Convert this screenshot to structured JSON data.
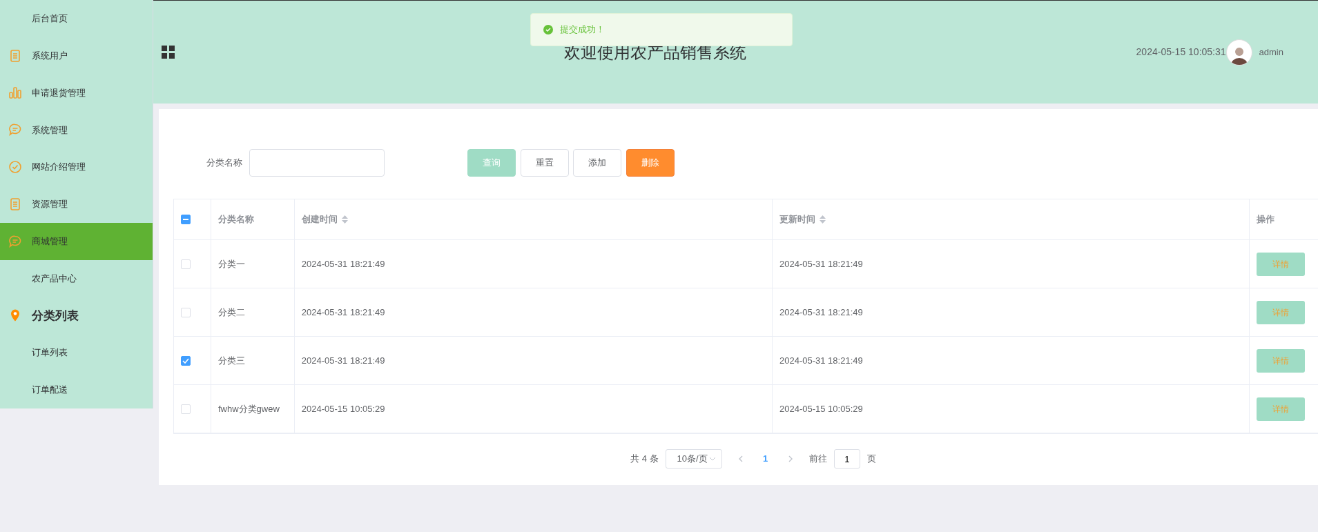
{
  "sidebar": {
    "items": [
      {
        "label": "后台首页",
        "kind": "plain",
        "selected": false,
        "emphasized": false
      },
      {
        "label": "系统用户",
        "kind": "document",
        "selected": false,
        "emphasized": false
      },
      {
        "label": "申请退货管理",
        "kind": "chart",
        "selected": false,
        "emphasized": false
      },
      {
        "label": "系统管理",
        "kind": "chat",
        "selected": false,
        "emphasized": false
      },
      {
        "label": "网站介绍管理",
        "kind": "check",
        "selected": false,
        "emphasized": false
      },
      {
        "label": "资源管理",
        "kind": "document",
        "selected": false,
        "emphasized": false
      },
      {
        "label": "商城管理",
        "kind": "chat",
        "selected": true,
        "emphasized": false
      },
      {
        "label": "农产品中心",
        "kind": "plain",
        "selected": false,
        "emphasized": false
      },
      {
        "label": "分类列表",
        "kind": "pin",
        "selected": false,
        "emphasized": true
      },
      {
        "label": "订单列表",
        "kind": "plain",
        "selected": false,
        "emphasized": false
      },
      {
        "label": "订单配送",
        "kind": "plain",
        "selected": false,
        "emphasized": false
      }
    ]
  },
  "header": {
    "title": "欢迎使用农产品销售系统",
    "datetime": "2024-05-15 10:05:31",
    "username": "admin"
  },
  "toast": {
    "message": "提交成功！"
  },
  "search": {
    "label": "分类名称"
  },
  "buttons": [
    {
      "label": "查询",
      "kind": "primary"
    },
    {
      "label": "重置",
      "kind": "default"
    },
    {
      "label": "添加",
      "kind": "default"
    },
    {
      "label": "删除",
      "kind": "danger"
    }
  ],
  "table": {
    "select_all": {
      "indeterminate": true
    },
    "columns": [
      {
        "label": "分类名称",
        "sortable": false
      },
      {
        "label": "创建时间",
        "sortable": true
      },
      {
        "label": "更新时间",
        "sortable": true
      },
      {
        "label": "操作",
        "sortable": false
      }
    ],
    "rows": [
      {
        "checked": false,
        "cells": [
          "分类一",
          "2024-05-31 18:21:49",
          "2024-05-31 18:21:49"
        ],
        "action": "详情"
      },
      {
        "checked": false,
        "cells": [
          "分类二",
          "2024-05-31 18:21:49",
          "2024-05-31 18:21:49"
        ],
        "action": "详情"
      },
      {
        "checked": true,
        "cells": [
          "分类三",
          "2024-05-31 18:21:49",
          "2024-05-31 18:21:49"
        ],
        "action": "详情"
      },
      {
        "checked": false,
        "cells": [
          "fwhw分类gwew",
          "2024-05-15 10:05:29",
          "2024-05-15 10:05:29"
        ],
        "action": "详情"
      }
    ]
  },
  "pagination": {
    "total": "共 4 条",
    "page_size": "10条/页",
    "pages": [
      {
        "label": "1",
        "selected": true
      }
    ],
    "goto_label": "前往",
    "goto_value": "1",
    "goto_suffix": "页"
  }
}
